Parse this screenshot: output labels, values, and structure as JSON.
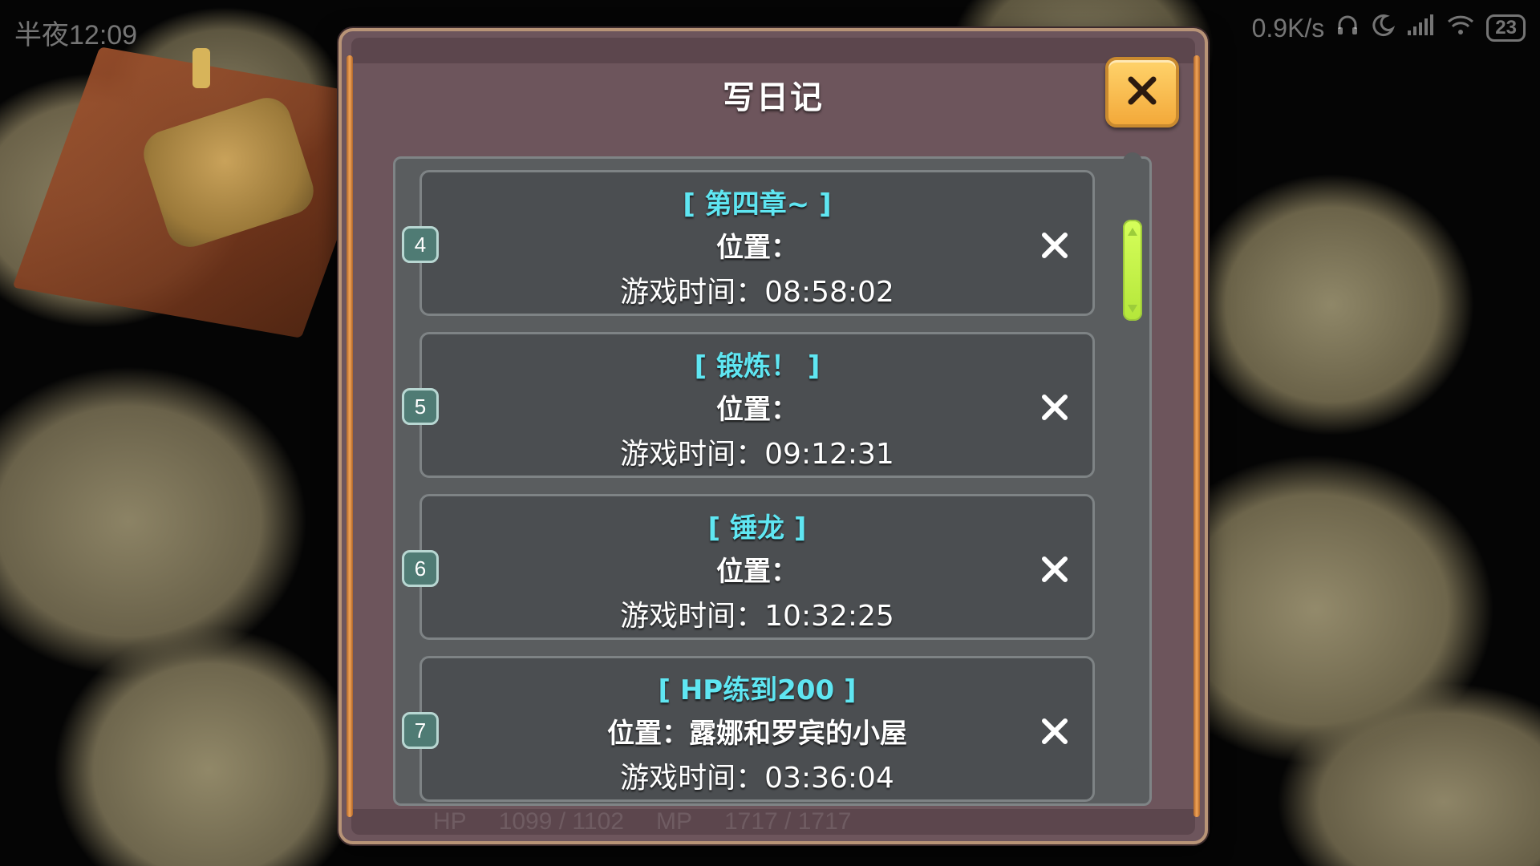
{
  "status_bar": {
    "time": "半夜12:09",
    "network_speed": "0.9K/s",
    "battery": "23",
    "icons": [
      "headphones-icon",
      "moon-icon",
      "signal-icon",
      "wifi-icon",
      "battery-icon"
    ]
  },
  "dialog": {
    "title": "写日记",
    "close_icon": "close-icon"
  },
  "diary_entries": [
    {
      "slot": "4",
      "title": "[ 第四章~ ]",
      "location": "位置：",
      "playtime": "游戏时间：08:58:02"
    },
    {
      "slot": "5",
      "title": "[ 锻炼！ ]",
      "location": "位置：",
      "playtime": "游戏时间：09:12:31"
    },
    {
      "slot": "6",
      "title": "[ 锤龙 ]",
      "location": "位置：",
      "playtime": "游戏时间：10:32:25"
    },
    {
      "slot": "7",
      "title": "[ HP练到200 ]",
      "location": "位置：露娜和罗宾的小屋",
      "playtime": "游戏时间：03:36:04"
    }
  ],
  "hud": {
    "hp_label": "HP",
    "hp_value": "1099 / 1102",
    "mp_label": "MP",
    "mp_value": "1717 / 1717"
  },
  "colors": {
    "entry_title": "#5fe6f2",
    "dialog_bg": "#6d555c",
    "close_button": "#f3a93a",
    "scroll_thumb": "#c8f54a",
    "slot_badge": "#4f7b74"
  }
}
